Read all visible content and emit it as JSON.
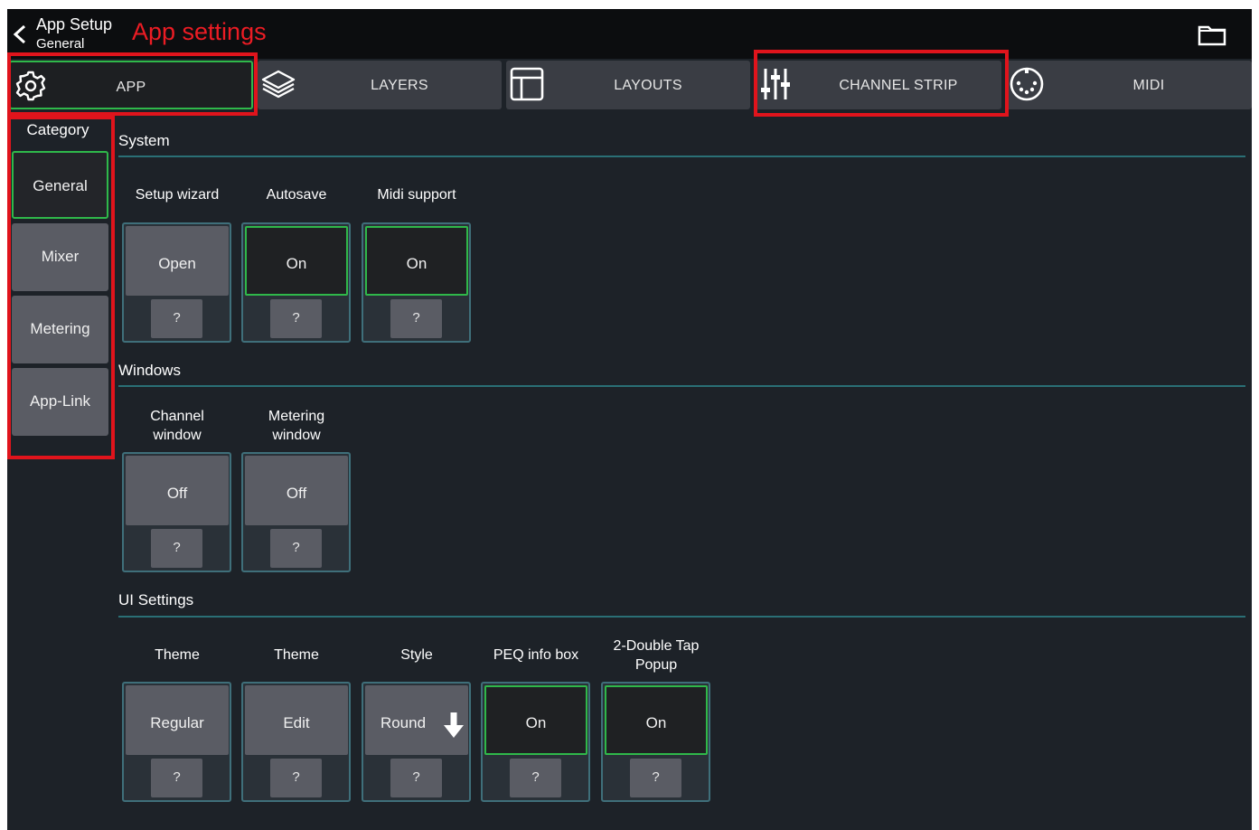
{
  "header": {
    "title": "App Setup",
    "subtitle": "General",
    "annotation": "App settings"
  },
  "tabs": [
    {
      "label": "APP",
      "icon": "gear-icon",
      "active": true
    },
    {
      "label": "LAYERS",
      "icon": "layers-icon",
      "active": false
    },
    {
      "label": "LAYOUTS",
      "icon": "layout-icon",
      "active": false
    },
    {
      "label": "CHANNEL STRIP",
      "icon": "sliders-icon",
      "active": false
    },
    {
      "label": "MIDI",
      "icon": "midi-connector-icon",
      "active": false
    }
  ],
  "sidebar": {
    "title": "Category",
    "items": [
      {
        "label": "General",
        "active": true
      },
      {
        "label": "Mixer",
        "active": false
      },
      {
        "label": "Metering",
        "active": false
      },
      {
        "label": "App-Link",
        "active": false
      }
    ]
  },
  "sections": {
    "system": {
      "title": "System",
      "settings": [
        {
          "label": "Setup wizard",
          "value": "Open",
          "help": "?"
        },
        {
          "label": "Autosave",
          "value": "On",
          "help": "?"
        },
        {
          "label": "Midi support",
          "value": "On",
          "help": "?"
        }
      ]
    },
    "windows": {
      "title": "Windows",
      "settings": [
        {
          "label": "Channel window",
          "value": "Off",
          "help": "?"
        },
        {
          "label": "Metering window",
          "value": "Off",
          "help": "?"
        }
      ]
    },
    "ui": {
      "title": "UI Settings",
      "settings": [
        {
          "label": "Theme",
          "value": "Regular",
          "help": "?"
        },
        {
          "label": "Theme",
          "value": "Edit",
          "help": "?"
        },
        {
          "label": "Style",
          "value": "Round",
          "help": "?"
        },
        {
          "label": "PEQ info box",
          "value": "On",
          "help": "?"
        },
        {
          "label": "2-Double Tap Popup",
          "value": "On",
          "help": "?"
        }
      ]
    }
  },
  "colors": {
    "active_green": "#2fb84a",
    "annotation_red": "#e0141c",
    "section_line": "#2a6f75",
    "background": "#1d2228"
  }
}
